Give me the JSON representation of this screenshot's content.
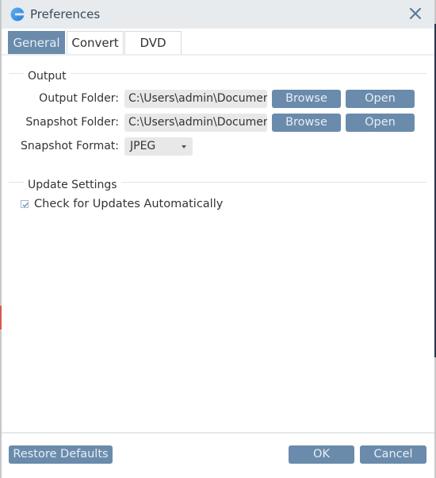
{
  "window": {
    "title": "Preferences",
    "icon": "app-logo-icon",
    "close_icon": "close-icon"
  },
  "tabs": [
    {
      "label": "General",
      "active": true
    },
    {
      "label": "Convert",
      "active": false
    },
    {
      "label": "DVD",
      "active": false
    }
  ],
  "output": {
    "group_label": "Output",
    "output_folder": {
      "label": "Output Folder:",
      "value": "C:\\Users\\admin\\Documents",
      "browse_label": "Browse",
      "open_label": "Open"
    },
    "snapshot_folder": {
      "label": "Snapshot Folder:",
      "value": "C:\\Users\\admin\\Documents",
      "browse_label": "Browse",
      "open_label": "Open"
    },
    "snapshot_format": {
      "label": "Snapshot Format:",
      "selected": "JPEG"
    }
  },
  "update_settings": {
    "group_label": "Update Settings",
    "check_updates": {
      "label": "Check for Updates Automatically",
      "checked": true
    }
  },
  "footer": {
    "restore_defaults_label": "Restore Defaults",
    "ok_label": "OK",
    "cancel_label": "Cancel"
  },
  "colors": {
    "accent": "#6a8bac",
    "titlebar": "#e8ebee",
    "field_bg": "#e8e8e8"
  }
}
